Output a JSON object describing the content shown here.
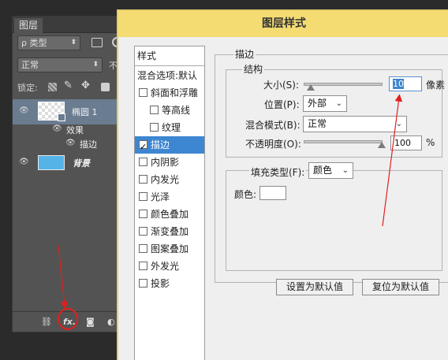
{
  "layers_panel": {
    "tab_label": "图层",
    "filter_select": "ρ 类型",
    "blend_mode": "正常",
    "opacity_label_partial": "不",
    "lock_label": "锁定:",
    "layers": [
      {
        "name": "椭圆 1",
        "type": "shape",
        "selected": true
      },
      {
        "name": "效果",
        "type": "effects-header"
      },
      {
        "name": "描边",
        "type": "effect"
      },
      {
        "name": "背景",
        "type": "background"
      }
    ],
    "bottom_fx_label": "fx."
  },
  "dialog": {
    "title": "图层样式",
    "styles_header": "样式",
    "styles": [
      {
        "label": "混合选项:默认",
        "checkbox": false,
        "checked": false,
        "indent": false,
        "selected": false
      },
      {
        "label": "斜面和浮雕",
        "checkbox": true,
        "checked": false,
        "indent": false,
        "selected": false
      },
      {
        "label": "等高线",
        "checkbox": true,
        "checked": false,
        "indent": true,
        "selected": false
      },
      {
        "label": "纹理",
        "checkbox": true,
        "checked": false,
        "indent": true,
        "selected": false
      },
      {
        "label": "描边",
        "checkbox": true,
        "checked": true,
        "indent": false,
        "selected": true
      },
      {
        "label": "内阴影",
        "checkbox": true,
        "checked": false,
        "indent": false,
        "selected": false
      },
      {
        "label": "内发光",
        "checkbox": true,
        "checked": false,
        "indent": false,
        "selected": false
      },
      {
        "label": "光泽",
        "checkbox": true,
        "checked": false,
        "indent": false,
        "selected": false
      },
      {
        "label": "颜色叠加",
        "checkbox": true,
        "checked": false,
        "indent": false,
        "selected": false
      },
      {
        "label": "渐变叠加",
        "checkbox": true,
        "checked": false,
        "indent": false,
        "selected": false
      },
      {
        "label": "图案叠加",
        "checkbox": true,
        "checked": false,
        "indent": false,
        "selected": false
      },
      {
        "label": "外发光",
        "checkbox": true,
        "checked": false,
        "indent": false,
        "selected": false
      },
      {
        "label": "投影",
        "checkbox": true,
        "checked": false,
        "indent": false,
        "selected": false
      }
    ],
    "stroke": {
      "section_title": "描边",
      "structure_title": "结构",
      "size_label": "大小(S):",
      "size_value": "10",
      "size_unit": "像素",
      "position_label": "位置(P):",
      "position_value": "外部",
      "blend_label": "混合模式(B):",
      "blend_value": "正常",
      "opacity_label": "不透明度(O):",
      "opacity_value": "100",
      "opacity_unit": "%",
      "fill_type_label": "填充类型(F):",
      "fill_type_value": "颜色",
      "color_label": "颜色:",
      "color_value": "#ffffff"
    },
    "buttons": {
      "set_default": "设置为默认值",
      "reset_default": "复位为默认值"
    }
  },
  "colors": {
    "title_bar": "#f4dc73",
    "selected_item": "#3d86d1",
    "annotation": "#e0201c"
  }
}
